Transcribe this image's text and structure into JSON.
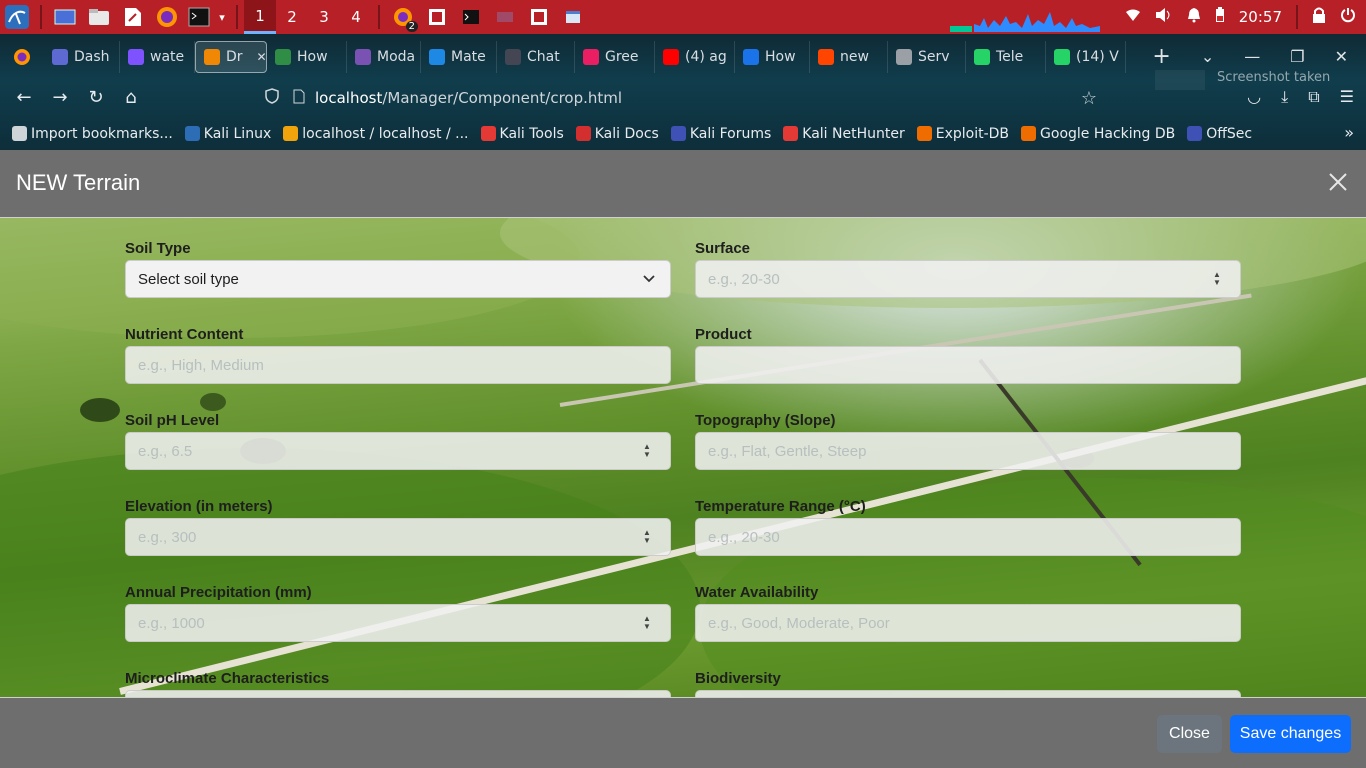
{
  "taskbar": {
    "workspaces": [
      "1",
      "2",
      "3",
      "4"
    ],
    "active_workspace": "1",
    "browser_badge": "2",
    "clock": "20:57"
  },
  "browser": {
    "tabs": [
      {
        "label": "Dash",
        "icon": "linear-icon",
        "color": "#5e6ad2"
      },
      {
        "label": "wate",
        "icon": "kotlin-icon",
        "color": "#7f52ff"
      },
      {
        "label": "Dr",
        "icon": "drawio-icon",
        "color": "#f08705",
        "active": true
      },
      {
        "label": "How",
        "icon": "gfg-icon",
        "color": "#2f8d46"
      },
      {
        "label": "Moda",
        "icon": "bootstrap-icon",
        "color": "#7952b3"
      },
      {
        "label": "Mate",
        "icon": "material-icon",
        "color": "#1e88e5"
      },
      {
        "label": "Chat",
        "icon": "chatgpt-icon",
        "color": "#444654"
      },
      {
        "label": "Gree",
        "icon": "greenhouse-icon",
        "color": "#e91e63"
      },
      {
        "label": "(4) ag",
        "icon": "youtube-icon",
        "color": "#ff0000"
      },
      {
        "label": "How",
        "icon": "uh-icon",
        "color": "#1a73e8"
      },
      {
        "label": "new",
        "icon": "reddit-icon",
        "color": "#ff4500"
      },
      {
        "label": "Serv",
        "icon": "info-icon",
        "color": "#9aa0a6"
      },
      {
        "label": "Tele",
        "icon": "whatsapp-icon",
        "color": "#25d366"
      },
      {
        "label": "(14) V",
        "icon": "whatsapp-badge-icon",
        "color": "#25d366"
      }
    ],
    "url_host": "localhost",
    "url_path": "/Manager/Component/crop.html",
    "toast": "Screenshot taken",
    "bookmarks": [
      {
        "label": "Import bookmarks...",
        "color": "#cfd4d9"
      },
      {
        "label": "Kali Linux",
        "color": "#2d6db5"
      },
      {
        "label": "localhost / localhost / ...",
        "color": "#f0a30a"
      },
      {
        "label": "Kali Tools",
        "color": "#e53935"
      },
      {
        "label": "Kali Docs",
        "color": "#d32f2f"
      },
      {
        "label": "Kali Forums",
        "color": "#3f51b5"
      },
      {
        "label": "Kali NetHunter",
        "color": "#e53935"
      },
      {
        "label": "Exploit-DB",
        "color": "#ef6c00"
      },
      {
        "label": "Google Hacking DB",
        "color": "#ef6c00"
      },
      {
        "label": "OffSec",
        "color": "#3f51b5"
      }
    ]
  },
  "modal": {
    "title": "NEW Terrain",
    "fields": [
      {
        "label": "Soil Type",
        "type": "select",
        "value": "Select soil type"
      },
      {
        "label": "Surface",
        "type": "number",
        "placeholder": "e.g., 20-30"
      },
      {
        "label": "Nutrient Content",
        "type": "text",
        "placeholder": "e.g., High, Medium"
      },
      {
        "label": "Product",
        "type": "text",
        "placeholder": ""
      },
      {
        "label": "Soil pH Level",
        "type": "number",
        "placeholder": "e.g., 6.5"
      },
      {
        "label": "Topography (Slope)",
        "type": "text",
        "placeholder": "e.g., Flat, Gentle, Steep"
      },
      {
        "label": "Elevation (in meters)",
        "type": "number",
        "placeholder": "e.g., 300"
      },
      {
        "label": "Temperature Range (°C)",
        "type": "text",
        "placeholder": "e.g., 20-30"
      },
      {
        "label": "Annual Precipitation (mm)",
        "type": "number",
        "placeholder": "e.g., 1000"
      },
      {
        "label": "Water Availability",
        "type": "text",
        "placeholder": "e.g., Good, Moderate, Poor"
      },
      {
        "label": "Microclimate Characteristics",
        "type": "text",
        "placeholder": ""
      },
      {
        "label": "Biodiversity",
        "type": "text",
        "placeholder": ""
      }
    ],
    "close_label": "Close",
    "save_label": "Save changes"
  },
  "colors": {
    "taskbar": "#b72027",
    "modal_chrome": "#6e6e6e",
    "primary": "#0d6efd",
    "secondary": "#6c757d"
  }
}
